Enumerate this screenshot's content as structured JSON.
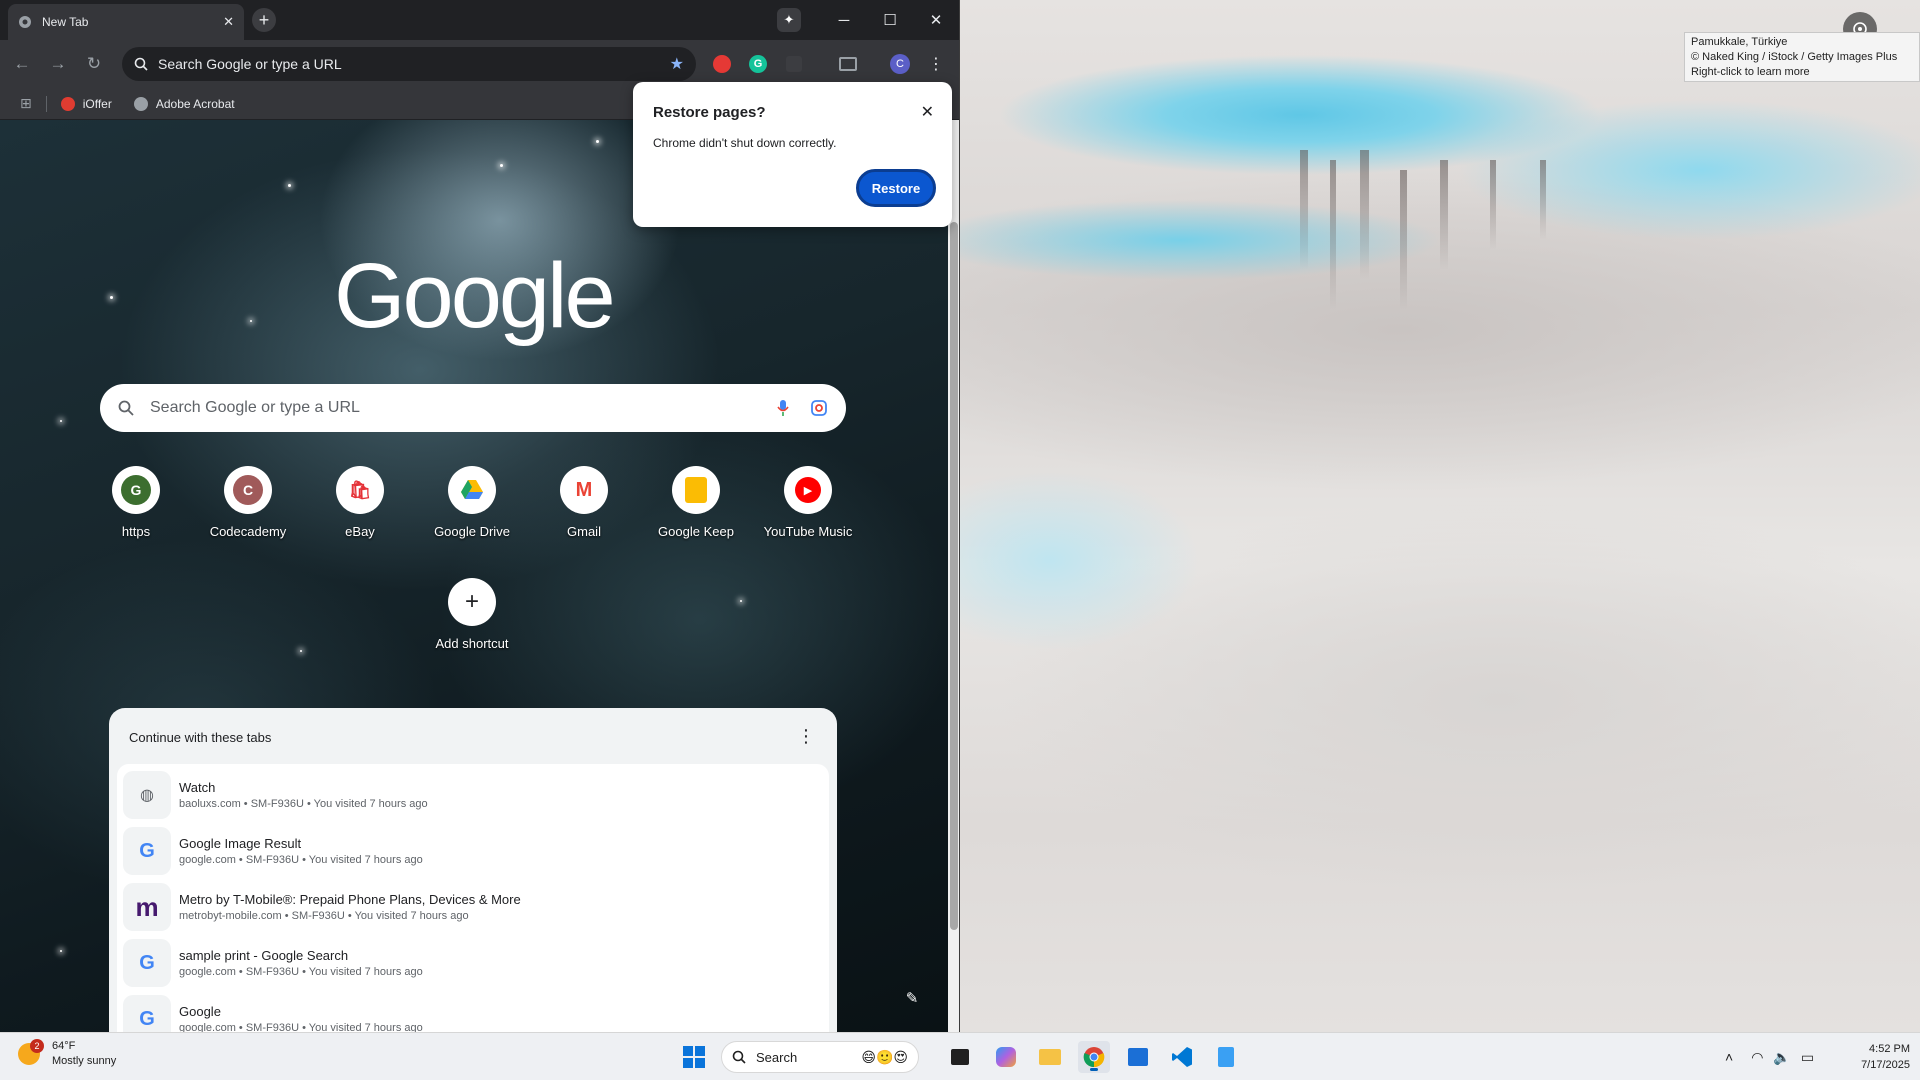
{
  "wallpaper": {
    "info_lines": [
      "Pamukkale, Türkiye",
      "© Naked King / iStock / Getty Images Plus",
      "Right-click to learn more"
    ]
  },
  "chrome": {
    "tab_title": "New Tab",
    "new_tab_label": "+",
    "omnibox_placeholder": "Search Google or type a URL",
    "profile_initial": "C",
    "bookmarks": [
      {
        "label": "iOffer",
        "color": "#e03c31"
      },
      {
        "label": "Adobe Acrobat",
        "color": "#9aa0a6"
      }
    ]
  },
  "ntp": {
    "logo_text": "Google",
    "search_placeholder": "Search Google or type a URL",
    "shortcuts": [
      {
        "label": "https",
        "glyph": "G",
        "color": "#3c6e2f"
      },
      {
        "label": "Codecademy",
        "glyph": "C",
        "color": "#a05a5a"
      },
      {
        "label": "eBay",
        "glyph": "🛍",
        "color": "#e53238"
      },
      {
        "label": "Google Drive",
        "glyph": "▲",
        "color": "#1fa463"
      },
      {
        "label": "Gmail",
        "glyph": "M",
        "color": "#ea4335"
      },
      {
        "label": "Google Keep",
        "glyph": "▣",
        "color": "#fbbc04"
      },
      {
        "label": "YouTube Music",
        "glyph": "▶",
        "color": "#ff0000"
      },
      {
        "label": "Add shortcut",
        "glyph": "+",
        "color": "#202124"
      }
    ],
    "tabs_card": {
      "header": "Continue with these tabs",
      "rows": [
        {
          "title": "Watch",
          "meta": "baoluxs.com • SM-F936U • You visited 7 hours ago",
          "icon": "globe-icon",
          "glyph": "◍",
          "color": "#5f6368"
        },
        {
          "title": "Google Image Result",
          "meta": "google.com • SM-F936U • You visited 7 hours ago",
          "icon": "google-icon",
          "glyph": "G",
          "color": "#4285f4"
        },
        {
          "title": "Metro by T-Mobile®: Prepaid Phone Plans, Devices & More",
          "meta": "metrobyt-mobile.com • SM-F936U • You visited 7 hours ago",
          "icon": "metro-icon",
          "glyph": "m",
          "color": "#46196e"
        },
        {
          "title": "sample print - Google Search",
          "meta": "google.com • SM-F936U • You visited 7 hours ago",
          "icon": "google-icon",
          "glyph": "G",
          "color": "#4285f4"
        },
        {
          "title": "Google",
          "meta": "google.com • SM-F936U • You visited 7 hours ago",
          "icon": "google-icon",
          "glyph": "G",
          "color": "#4285f4"
        }
      ]
    }
  },
  "restore_dialog": {
    "title": "Restore pages?",
    "message": "Chrome didn't shut down correctly.",
    "button": "Restore"
  },
  "taskbar": {
    "weather_badge": "2",
    "weather_temp": "64°F",
    "weather_desc": "Mostly sunny",
    "search_label": "Search",
    "time": "4:52 PM",
    "date": "7/17/2025",
    "accent": "#005fb8"
  }
}
